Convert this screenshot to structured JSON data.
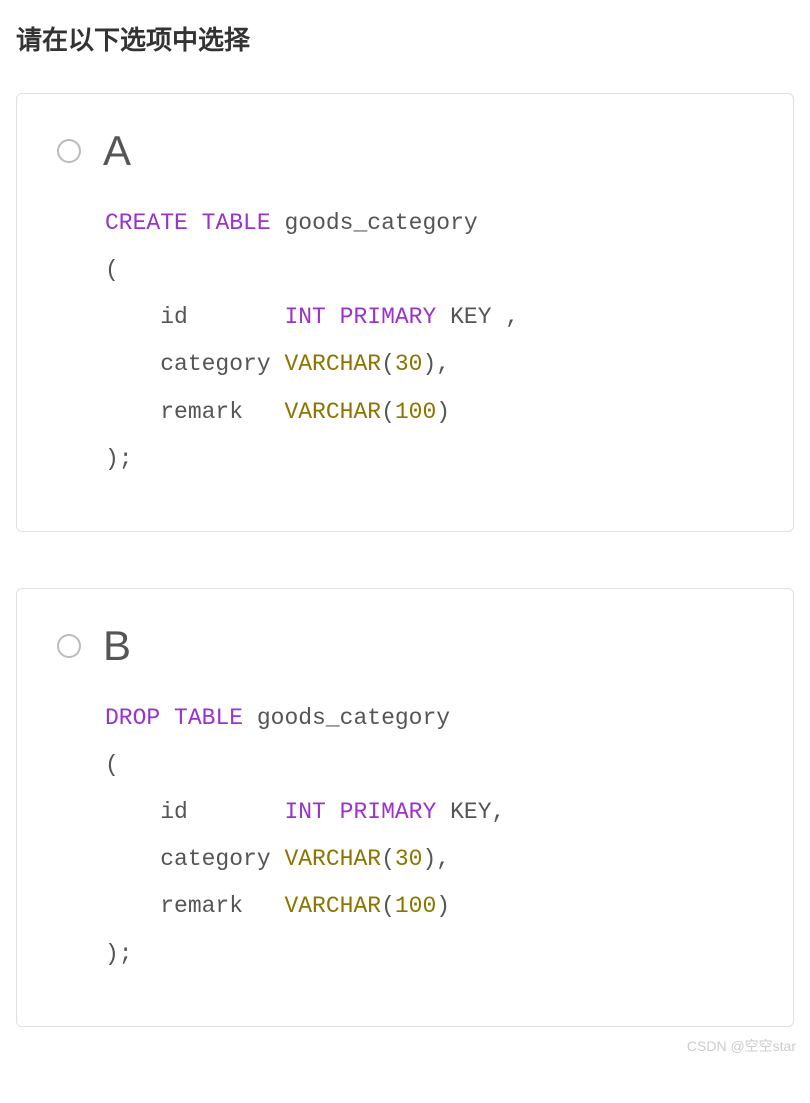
{
  "prompt": "请在以下选项中选择",
  "options": {
    "a": {
      "letter": "A",
      "code": {
        "l1_kw1": "CREATE",
        "l1_kw2": "TABLE",
        "l1_rest": " goods_category",
        "l2": "(",
        "l3_pre": "    id       ",
        "l3_kw1": "INT",
        "l3_kw2": "PRIMARY",
        "l3_rest": " KEY ,",
        "l4_pre": "    category ",
        "l4_kw1": "VARCHAR",
        "l4_paren1": "(",
        "l4_num": "30",
        "l4_paren2": ")",
        "l4_rest": ",",
        "l5_pre": "    remark   ",
        "l5_kw1": "VARCHAR",
        "l5_paren1": "(",
        "l5_num": "100",
        "l5_paren2": ")",
        "l6": ");"
      }
    },
    "b": {
      "letter": "B",
      "code": {
        "l1_kw1": "DROP",
        "l1_kw2": "TABLE",
        "l1_rest": " goods_category",
        "l2": "(",
        "l3_pre": "    id       ",
        "l3_kw1": "INT",
        "l3_kw2": "PRIMARY",
        "l3_rest": " KEY,",
        "l4_pre": "    category ",
        "l4_kw1": "VARCHAR",
        "l4_paren1": "(",
        "l4_num": "30",
        "l4_paren2": ")",
        "l4_rest": ",",
        "l5_pre": "    remark   ",
        "l5_kw1": "VARCHAR",
        "l5_paren1": "(",
        "l5_num": "100",
        "l5_paren2": ")",
        "l6": ");"
      }
    }
  },
  "watermark": "CSDN @空空star"
}
